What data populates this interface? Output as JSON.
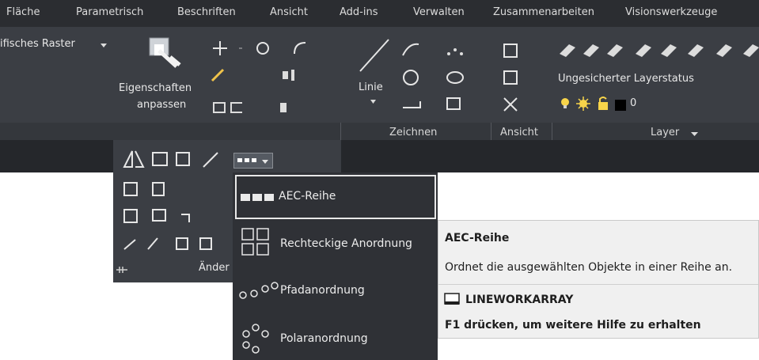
{
  "tabs": [
    "Fläche",
    "Parametrisch",
    "Beschriften",
    "Ansicht",
    "Add-ins",
    "Verwalten",
    "Zusammenarbeiten",
    "Visionswerkzeuge"
  ],
  "ribbon": {
    "raster_label": "ifisches Raster",
    "eigenschaften_line1": "Eigenschaften",
    "eigenschaften_line2": "anpassen",
    "linie_label": "Linie",
    "layer_status": "Ungesicherter Layerstatus",
    "layer_number": "0",
    "panels": {
      "zeichnen": "Zeichnen",
      "ansicht": "Ansicht",
      "layer": "Layer"
    },
    "andern_label": "Änder"
  },
  "flyout": {
    "items": [
      "AEC-Reihe",
      "Rechteckige Anordnung",
      "Pfadanordnung",
      "Polaranordnung"
    ]
  },
  "tooltip": {
    "title": "AEC-Reihe",
    "description": "Ordnet die ausgewählten Objekte in einer Reihe an.",
    "command": "LINEWORKARRAY",
    "help": "F1 drücken, um weitere Hilfe zu erhalten"
  },
  "colors": {
    "tab_bg": "#2b2d31",
    "ribbon_bg": "#3b3e44",
    "flyout_bg": "#2f3136",
    "tooltip_bg": "#f0f0f0"
  }
}
